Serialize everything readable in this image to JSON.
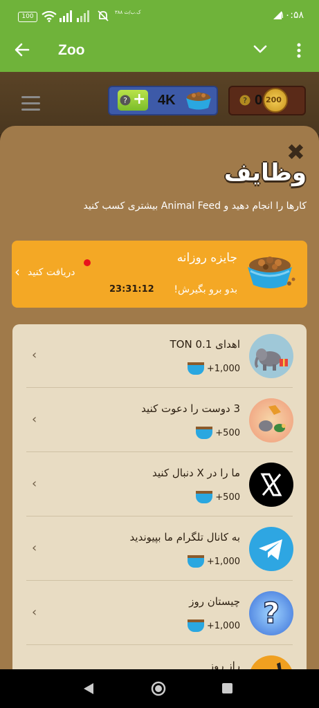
{
  "status_bar": {
    "battery": "100",
    "tiny_text": "۳۸۸ ک.ب/ث",
    "time": "۱۰:۵۸"
  },
  "app_bar": {
    "title": "Zoo"
  },
  "game_header": {
    "feed_amount": "4K",
    "coins_amount": "0",
    "coin_badge": "200"
  },
  "sheet": {
    "title": "وظایف",
    "subtitle": "کارها را انجام دهید و Animal Feed بیشتری کسب کنید"
  },
  "daily_reward": {
    "title": "جایزه روزانه",
    "subtitle": "بدو برو بگیرش!",
    "timer": "23:31:12",
    "claim_label": "دریافت کنید"
  },
  "tasks": [
    {
      "name": "اهدای 0.1 TON",
      "reward": "+1,000",
      "icon": "elephant-gift-icon"
    },
    {
      "name": "3 دوست را دعوت کنید",
      "reward": "+500",
      "icon": "animals-friends-icon"
    },
    {
      "name": "ما را در X دنبال کنید",
      "reward": "+500",
      "icon": "x-logo-icon"
    },
    {
      "name": "به کانال تلگرام ما بپیوندید",
      "reward": "+1,000",
      "icon": "telegram-icon"
    },
    {
      "name": "چیستان روز",
      "reward": "+1,000",
      "icon": "riddle-question-icon"
    },
    {
      "name": "راز روز",
      "reward": "",
      "icon": "safari-silhouette-icon"
    }
  ],
  "colors": {
    "app_bar": "#6fb33a",
    "sheet": "#a07a4a",
    "card": "#e8dcc3",
    "daily": "#f4a825",
    "telegram": "#2ea6e2"
  }
}
